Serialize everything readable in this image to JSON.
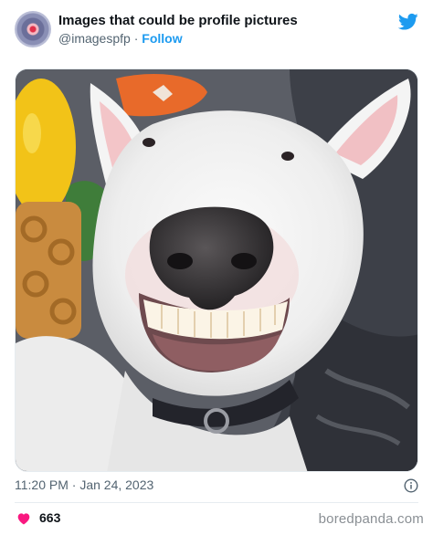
{
  "account": {
    "display_name": "Images that could be profile pictures",
    "handle": "@imagespfp",
    "separator": "·",
    "follow_label": "Follow"
  },
  "icons": {
    "brand": "twitter-bird-icon",
    "info": "info-icon",
    "like": "heart-icon"
  },
  "tweet": {
    "timestamp": "11:20 PM · Jan 24, 2023",
    "likes": "663"
  },
  "watermark": "boredpanda.com",
  "colors": {
    "accent": "#1d9bf0",
    "like": "#f91880",
    "muted": "#536471"
  }
}
